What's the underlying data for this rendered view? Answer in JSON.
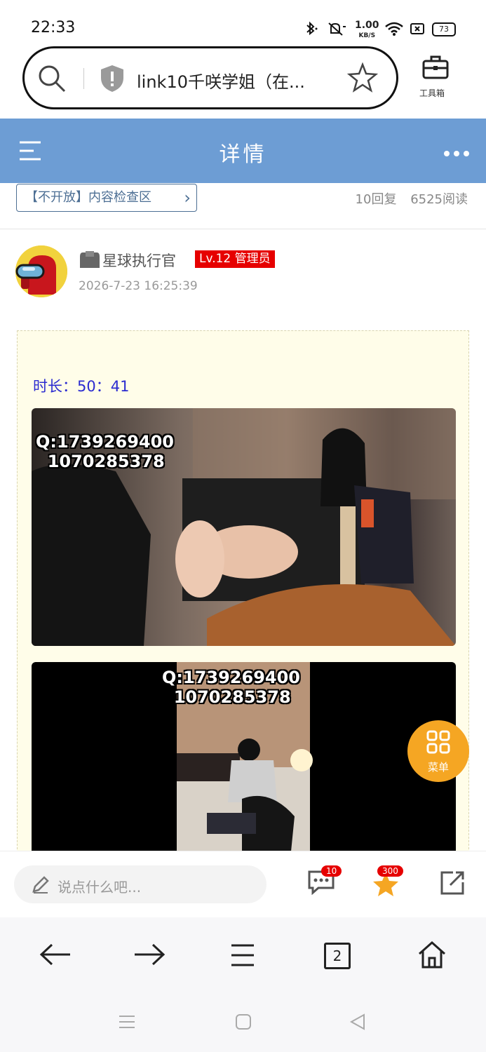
{
  "status_bar": {
    "time": "22:33",
    "net_speed_value": "1.00",
    "net_speed_unit": "KB/S",
    "battery": "73",
    "icons": [
      "bluetooth-icon",
      "mute-icon",
      "wifi-icon",
      "sim-icon",
      "battery-icon"
    ]
  },
  "search": {
    "url_text": "link10千咲学姐（在...",
    "toolbox_label": "工具箱",
    "icons": [
      "search-icon",
      "shield-icon",
      "star-icon",
      "toolbox-icon"
    ]
  },
  "header": {
    "title": "详情",
    "icons": [
      "menu-icon",
      "more-icon"
    ]
  },
  "board": {
    "label": "【不开放】内容检查区",
    "chevron": "›",
    "replies": "10回复",
    "views": "6525阅读"
  },
  "post": {
    "author": "星球执行官",
    "level": "Lv.12 管理员",
    "time": "2026-7-23 16:25:39",
    "duration": "时长：50：41",
    "watermark_1": "Q:1739269400\n  1070285378",
    "watermark_2": "Q:1739269400\n  1070285378"
  },
  "fab": {
    "label": "菜单",
    "icon": "grid-icon"
  },
  "comment_bar": {
    "placeholder": "说点什么吧...",
    "comments_count": "10",
    "favorites_count": "300",
    "icons": [
      "pencil-icon",
      "comment-icon",
      "star-icon",
      "share-icon"
    ]
  },
  "browser_nav": {
    "tabs_count": "2",
    "icons": [
      "back-icon",
      "forward-icon",
      "menu-icon",
      "tabs-icon",
      "home-icon"
    ]
  },
  "colors": {
    "header_blue": "#6d9dd4",
    "badge_red": "#e60000",
    "fab_orange": "#f5a623",
    "duration_blue": "#2b2bd0",
    "content_bg": "#fffde9"
  }
}
